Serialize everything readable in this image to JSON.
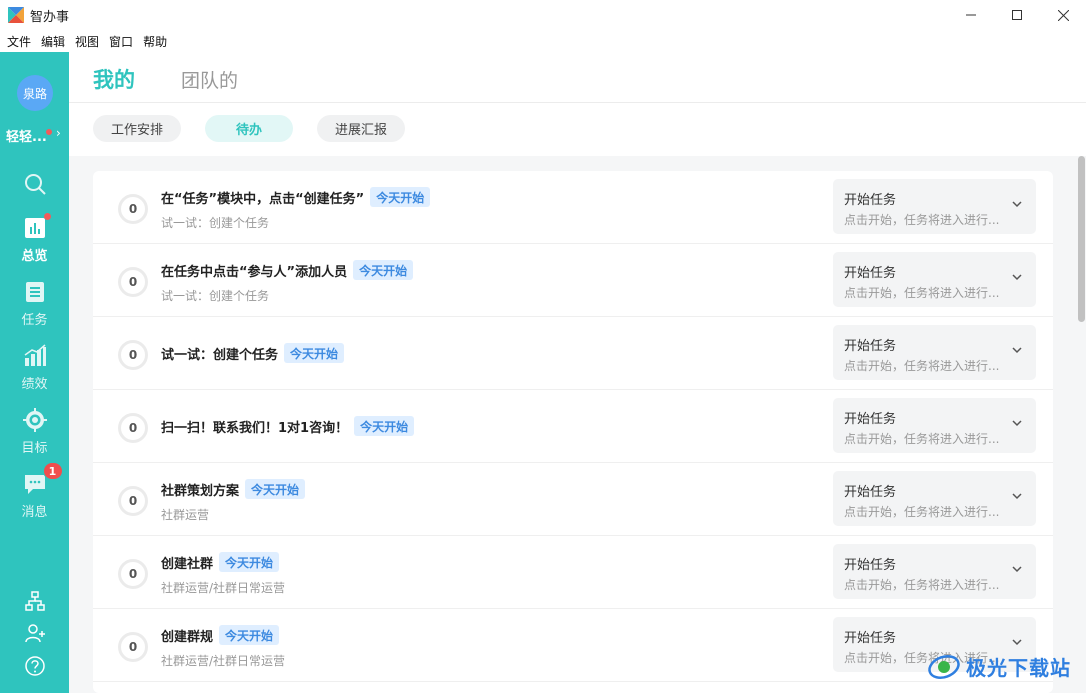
{
  "window": {
    "title": "智办事"
  },
  "menu": [
    "文件",
    "编辑",
    "视图",
    "窗口",
    "帮助"
  ],
  "sidebar": {
    "avatar_text": "泉路",
    "user_name": "轻轻...",
    "nav": [
      {
        "label": "总览",
        "icon": "chart-icon",
        "active": true,
        "dot": true
      },
      {
        "label": "任务",
        "icon": "task-list-icon"
      },
      {
        "label": "绩效",
        "icon": "performance-icon"
      },
      {
        "label": "目标",
        "icon": "target-icon"
      },
      {
        "label": "消息",
        "icon": "message-icon",
        "badge": "1"
      }
    ],
    "bottom_icons": [
      "org-chart-icon",
      "add-user-icon",
      "help-icon"
    ]
  },
  "header": {
    "tabs": [
      "我的",
      "团队的"
    ]
  },
  "subtabs": [
    "工作安排",
    "待办",
    "进展汇报"
  ],
  "tasks": [
    {
      "count": "0",
      "title": "在“任务”模块中，点击“创建任务”",
      "badge": "今天开始",
      "sub": "试一试：创建个任务",
      "action": "开始任务",
      "action_desc": "点击开始，任务将进入进行..."
    },
    {
      "count": "0",
      "title": "在任务中点击“参与人”添加人员",
      "badge": "今天开始",
      "sub": "试一试：创建个任务",
      "action": "开始任务",
      "action_desc": "点击开始，任务将进入进行..."
    },
    {
      "count": "0",
      "title": "试一试：创建个任务",
      "badge": "今天开始",
      "sub": "",
      "action": "开始任务",
      "action_desc": "点击开始，任务将进入进行..."
    },
    {
      "count": "0",
      "title": "扫一扫！联系我们！1对1咨询！",
      "badge": "今天开始",
      "sub": "",
      "action": "开始任务",
      "action_desc": "点击开始，任务将进入进行..."
    },
    {
      "count": "0",
      "title": "社群策划方案",
      "badge": "今天开始",
      "sub": "社群运营",
      "action": "开始任务",
      "action_desc": "点击开始，任务将进入进行..."
    },
    {
      "count": "0",
      "title": "创建社群",
      "badge": "今天开始",
      "sub": "社群运营/社群日常运营",
      "action": "开始任务",
      "action_desc": "点击开始，任务将进入进行..."
    },
    {
      "count": "0",
      "title": "创建群规",
      "badge": "今天开始",
      "sub": "社群运营/社群日常运营",
      "action": "开始任务",
      "action_desc": "点击开始，任务将进入进行..."
    }
  ],
  "watermark": "极光下载站",
  "colors": {
    "accent": "#2fc4be",
    "badge_bg": "#dfeeff",
    "badge_text": "#3d8ae0",
    "alert": "#f04e4e"
  }
}
